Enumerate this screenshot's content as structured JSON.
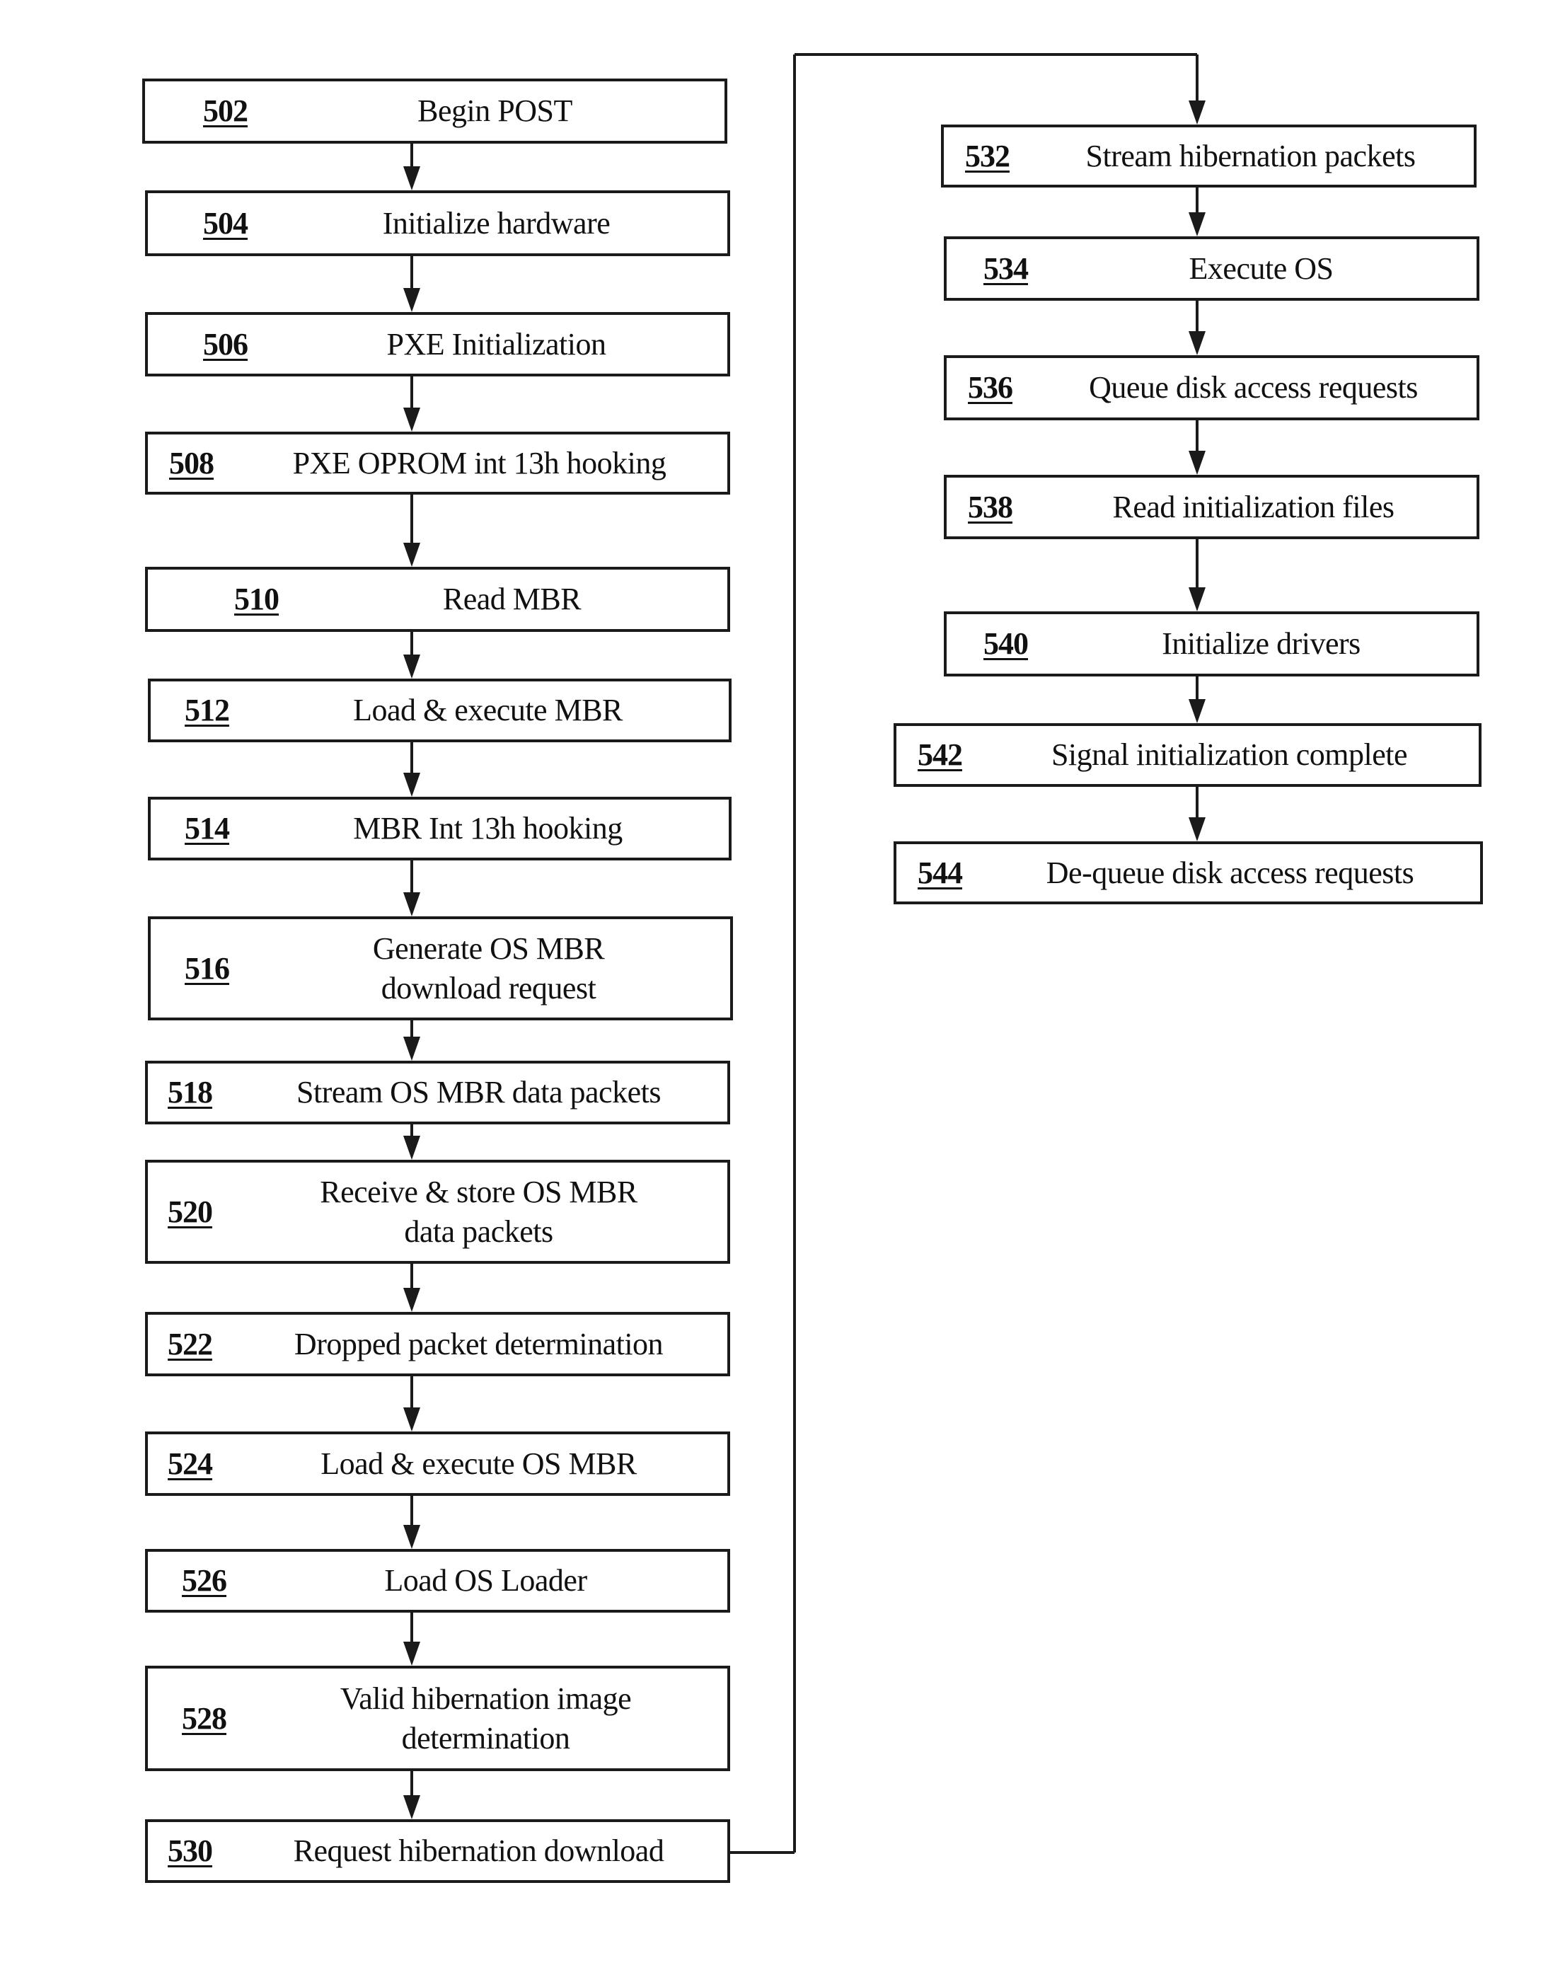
{
  "figure": {
    "type": "flowchart",
    "left_column": [
      {
        "id": "502",
        "text": [
          "Begin POST"
        ]
      },
      {
        "id": "504",
        "text": [
          "Initialize hardware"
        ]
      },
      {
        "id": "506",
        "text": [
          "PXE Initialization"
        ]
      },
      {
        "id": "508",
        "text": [
          "PXE OPROM int 13h hooking"
        ]
      },
      {
        "id": "510",
        "text": [
          "Read MBR"
        ]
      },
      {
        "id": "512",
        "text": [
          "Load & execute MBR"
        ]
      },
      {
        "id": "514",
        "text": [
          "MBR Int 13h hooking"
        ]
      },
      {
        "id": "516",
        "text": [
          "Generate OS MBR",
          "download request"
        ]
      },
      {
        "id": "518",
        "text": [
          "Stream OS MBR data packets"
        ]
      },
      {
        "id": "520",
        "text": [
          "Receive & store OS MBR",
          "data packets"
        ]
      },
      {
        "id": "522",
        "text": [
          "Dropped packet determination"
        ]
      },
      {
        "id": "524",
        "text": [
          "Load & execute OS MBR"
        ]
      },
      {
        "id": "526",
        "text": [
          "Load OS Loader"
        ]
      },
      {
        "id": "528",
        "text": [
          "Valid hibernation image",
          "determination"
        ]
      },
      {
        "id": "530",
        "text": [
          "Request hibernation download"
        ]
      }
    ],
    "right_column": [
      {
        "id": "532",
        "text": [
          "Stream hibernation packets"
        ]
      },
      {
        "id": "534",
        "text": [
          "Execute OS"
        ]
      },
      {
        "id": "536",
        "text": [
          "Queue disk access requests"
        ]
      },
      {
        "id": "538",
        "text": [
          "Read initialization files"
        ]
      },
      {
        "id": "540",
        "text": [
          "Initialize drivers"
        ]
      },
      {
        "id": "542",
        "text": [
          "Signal initialization complete"
        ]
      },
      {
        "id": "544",
        "text": [
          "De-queue disk access requests"
        ]
      }
    ],
    "connections": [
      [
        "502",
        "504"
      ],
      [
        "504",
        "506"
      ],
      [
        "506",
        "508"
      ],
      [
        "508",
        "510"
      ],
      [
        "510",
        "512"
      ],
      [
        "512",
        "514"
      ],
      [
        "514",
        "516"
      ],
      [
        "516",
        "518"
      ],
      [
        "518",
        "520"
      ],
      [
        "520",
        "522"
      ],
      [
        "522",
        "524"
      ],
      [
        "524",
        "526"
      ],
      [
        "526",
        "528"
      ],
      [
        "528",
        "530"
      ],
      [
        "530",
        "532"
      ],
      [
        "532",
        "534"
      ],
      [
        "534",
        "536"
      ],
      [
        "536",
        "538"
      ],
      [
        "538",
        "540"
      ],
      [
        "540",
        "542"
      ],
      [
        "542",
        "544"
      ]
    ]
  }
}
